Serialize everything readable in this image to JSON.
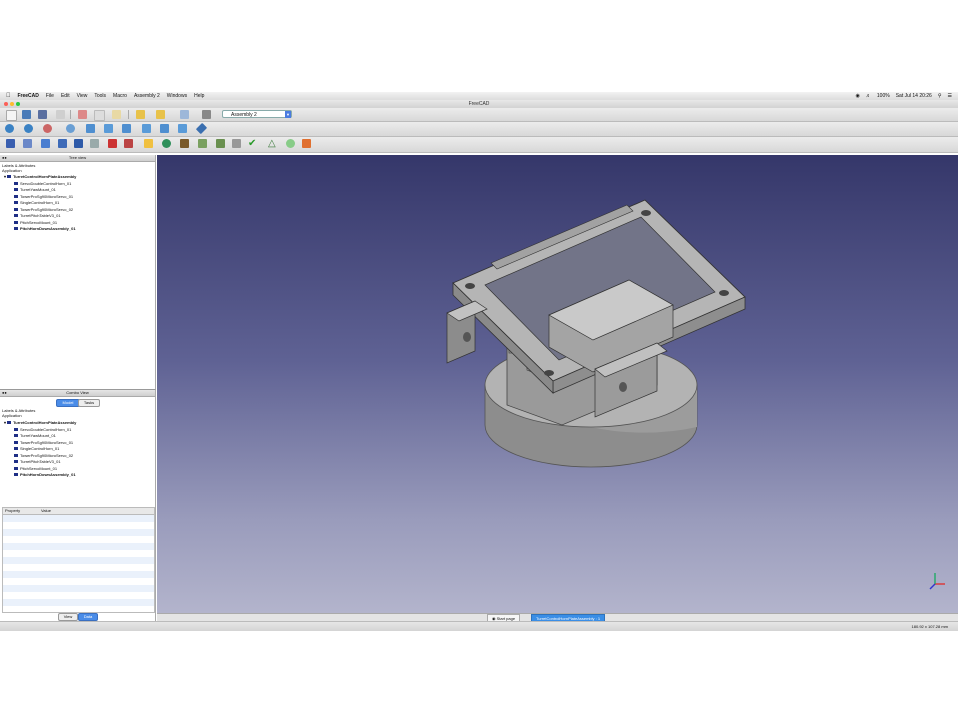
{
  "menubar": {
    "app_name": "FreeCAD",
    "items": [
      "File",
      "Edit",
      "View",
      "Tools",
      "Macro",
      "Assembly 2",
      "Windows",
      "Help"
    ],
    "battery": "100%",
    "clock": "Sat Jul 14  20:26"
  },
  "window": {
    "title": "FreeCAD"
  },
  "toolbar": {
    "workbench": "Assembly 2"
  },
  "tree_view": {
    "title": "Tree view",
    "section_label": "Labels & Attributes",
    "app_label": "Application",
    "root": "TurretControlHornPlateAssembly",
    "children": [
      "ServoDoubleControlHorn_01",
      "TurretYawMount_01",
      "TowerProSg90MicroServo_01",
      "SingleControlHorn_01",
      "TowerProSg90MicroServo_02",
      "TurretPitchTableV3_01",
      "PitchServoMount_01",
      "PitchHornDownAssembly_01"
    ]
  },
  "combo_view": {
    "title": "Combo View",
    "tabs": [
      "Model",
      "Tasks"
    ],
    "section_label": "Labels & Attributes",
    "app_label": "Application",
    "root": "TurretControlHornPlateAssembly",
    "children": [
      "ServoDoubleControlHorn_01",
      "TurretYawMount_01",
      "TowerProSg90MicroServo_01",
      "SingleControlHorn_01",
      "TowerProSg90MicroServo_02",
      "TurretPitchTableV3_01",
      "PitchServoMount_01",
      "PitchHornDownAssembly_01"
    ],
    "property_header": "Property",
    "value_header": "Value",
    "bottom_tabs": [
      "View",
      "Data"
    ]
  },
  "doc_tabs": [
    "Start page",
    "TurretControlHornPlateAssembly : 1"
  ],
  "status": {
    "dimensions": "180.92 x 107.28 mm"
  },
  "colors": {
    "selected_tab": "#3a8ee6",
    "tree_icon": "#1f2f86",
    "viewport_top": "#35376a",
    "viewport_bottom": "#b3b4cc"
  }
}
